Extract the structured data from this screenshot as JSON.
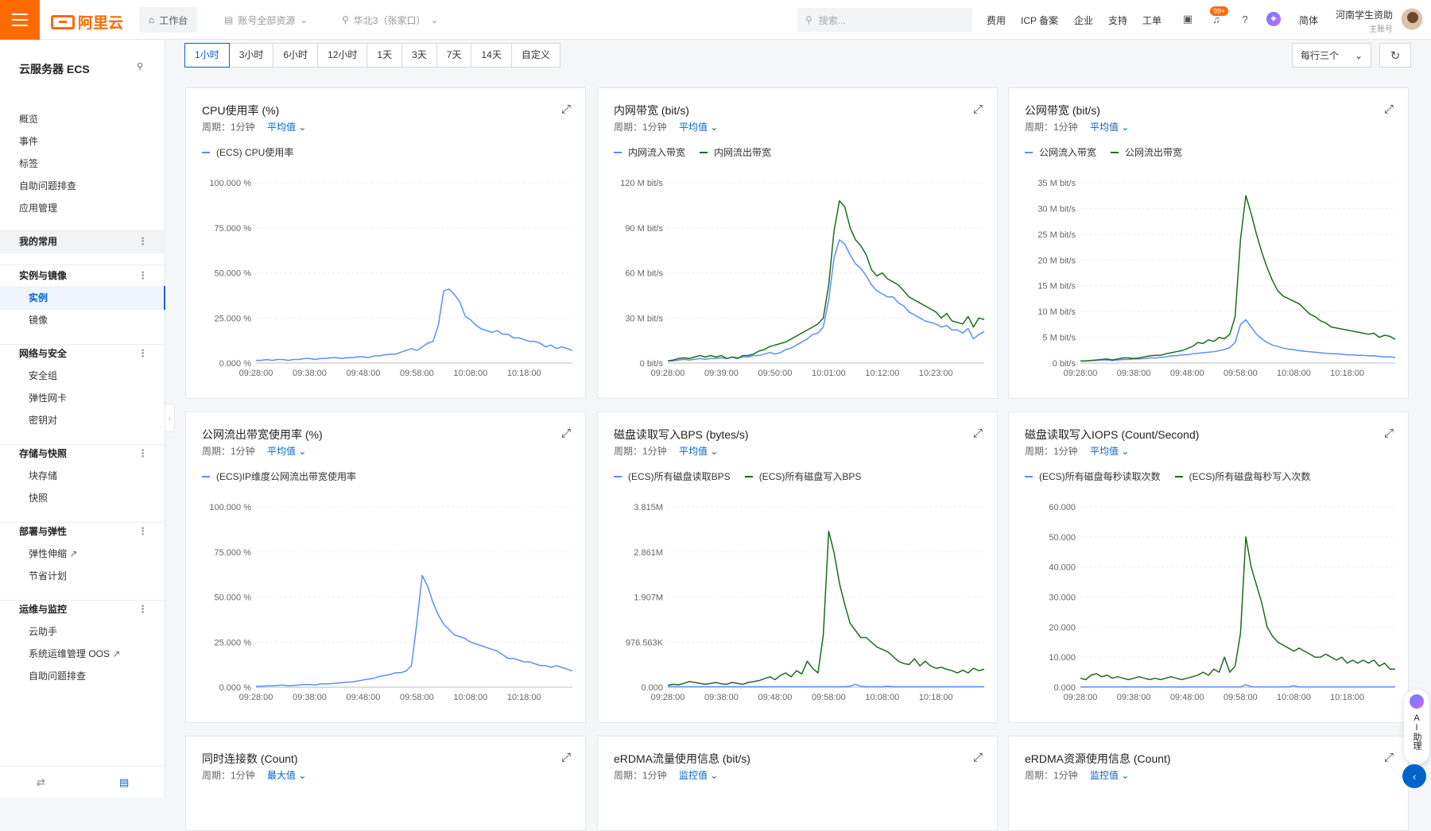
{
  "topbar": {
    "logo_text": "阿里云",
    "workbench": "工作台",
    "resource_scope": "账号全部资源",
    "region": "华北3（张家口）",
    "search_placeholder": "搜索...",
    "links": [
      "费用",
      "ICP 备案",
      "企业",
      "支持",
      "工单"
    ],
    "notif_badge": "99+",
    "lang": "简体",
    "account_name": "河南学生资助",
    "account_sub": "主账号"
  },
  "sidebar": {
    "title": "云服务器 ECS",
    "items": [
      {
        "label": "概览",
        "type": "item"
      },
      {
        "label": "事件",
        "type": "item"
      },
      {
        "label": "标签",
        "type": "item"
      },
      {
        "label": "自助问题排查",
        "type": "item"
      },
      {
        "label": "应用管理",
        "type": "item"
      },
      {
        "label": "我的常用",
        "type": "group"
      },
      {
        "label": "实例与镜像",
        "type": "group"
      },
      {
        "label": "实例",
        "type": "sub"
      },
      {
        "label": "镜像",
        "type": "sub"
      },
      {
        "label": "网络与安全",
        "type": "group"
      },
      {
        "label": "安全组",
        "type": "sub"
      },
      {
        "label": "弹性网卡",
        "type": "sub"
      },
      {
        "label": "密钥对",
        "type": "sub"
      },
      {
        "label": "存储与快照",
        "type": "group"
      },
      {
        "label": "块存储",
        "type": "sub"
      },
      {
        "label": "快照",
        "type": "sub"
      },
      {
        "label": "部署与弹性",
        "type": "group"
      },
      {
        "label": "弹性伸缩",
        "type": "sub"
      },
      {
        "label": "节省计划",
        "type": "sub"
      },
      {
        "label": "运维与监控",
        "type": "group"
      },
      {
        "label": "云助手",
        "type": "sub"
      },
      {
        "label": "系统运维管理 OOS",
        "type": "sub"
      },
      {
        "label": "自助问题排查",
        "type": "sub"
      }
    ]
  },
  "time_ranges": [
    "1小时",
    "3小时",
    "6小时",
    "12小时",
    "1天",
    "3天",
    "7天",
    "14天",
    "自定义"
  ],
  "active_range": "1小时",
  "per_row": "每行三个",
  "period_label": "周期：1分钟",
  "ai_assistant": "AI助理",
  "colors": {
    "blue": "#5b8ff9",
    "green": "#1e6b1e",
    "accent": "#0064c8",
    "brand": "#ff6a00"
  },
  "panels": [
    {
      "title": "CPU使用率 (%)",
      "agg": "平均值",
      "chart_data": {
        "type": "line",
        "x": [
          "09:28:00",
          "09:38:00",
          "09:48:00",
          "09:58:00",
          "10:08:00",
          "10:18:00"
        ],
        "y_ticks": [
          "0.000 %",
          "25.000 %",
          "50.000 %",
          "75.000 %",
          "100.000 %"
        ],
        "ylim": [
          0,
          100
        ],
        "series": [
          {
            "name": "(ECS) CPU使用率",
            "color": "blue",
            "values": [
              1.5,
              1.5,
              2,
              1.5,
              2,
              2,
              1.5,
              2,
              2,
              2.5,
              2.5,
              2,
              2.5,
              2.5,
              3,
              3,
              2.5,
              3,
              3,
              3.5,
              3.5,
              3,
              4,
              4,
              4.5,
              5,
              5,
              6,
              7,
              8,
              7,
              9,
              11,
              12,
              21,
              40,
              41,
              38,
              34,
              26,
              24,
              21,
              19,
              18,
              17,
              18,
              16,
              16,
              14,
              14,
              13,
              12,
              12,
              11,
              9,
              10,
              8,
              9,
              8,
              7
            ]
          }
        ]
      }
    },
    {
      "title": "内网带宽 (bit/s)",
      "agg": "平均值",
      "chart_data": {
        "type": "line",
        "x": [
          "09:28:00",
          "09:39:00",
          "09:50:00",
          "10:01:00",
          "10:12:00",
          "10:23:00"
        ],
        "y_ticks": [
          "0  bit/s",
          "30 M bit/s",
          "60 M bit/s",
          "90 M bit/s",
          "120 M bit/s"
        ],
        "ylim": [
          0,
          120
        ],
        "series": [
          {
            "name": "内网流入带宽",
            "color": "blue",
            "values": [
              1.5,
              1.5,
              2,
              2.5,
              2,
              2.5,
              3,
              2.5,
              3,
              3,
              3.5,
              3,
              4,
              3.5,
              4,
              4,
              5,
              5,
              6,
              7,
              6,
              7,
              9,
              10,
              12,
              14,
              16,
              19,
              20,
              24,
              42,
              70,
              82,
              79,
              72,
              66,
              63,
              58,
              52,
              48,
              46,
              44,
              44,
              40,
              38,
              34,
              32,
              30,
              28,
              27,
              26,
              24,
              25,
              22,
              22,
              20,
              23,
              16,
              19,
              21
            ]
          },
          {
            "name": "内网流出带宽",
            "color": "green",
            "values": [
              1.5,
              2,
              3,
              3.5,
              3,
              4,
              5,
              4,
              5,
              4,
              5,
              3,
              4,
              3,
              5,
              5,
              6,
              8,
              9,
              11,
              12,
              13,
              14,
              16,
              18,
              20,
              22,
              24,
              26,
              30,
              52,
              88,
              108,
              104,
              90,
              82,
              78,
              72,
              62,
              58,
              60,
              56,
              54,
              52,
              48,
              44,
              42,
              40,
              38,
              36,
              34,
              30,
              33,
              28,
              27,
              26,
              31,
              24,
              30,
              29
            ]
          }
        ]
      }
    },
    {
      "title": "公网带宽 (bit/s)",
      "agg": "平均值",
      "chart_data": {
        "type": "line",
        "x": [
          "09:28:00",
          "09:38:00",
          "09:48:00",
          "09:58:00",
          "10:08:00",
          "10:18:00"
        ],
        "y_ticks": [
          "0  bit/s",
          "5 M bit/s",
          "10 M bit/s",
          "15 M bit/s",
          "20 M bit/s",
          "25 M bit/s",
          "30 M bit/s",
          "35 M bit/s"
        ],
        "ylim": [
          0,
          35
        ],
        "series": [
          {
            "name": "公网流入带宽",
            "color": "blue",
            "values": [
              0.4,
              0.4,
              0.5,
              0.5,
              0.6,
              0.6,
              0.5,
              0.6,
              0.7,
              0.7,
              0.8,
              0.8,
              0.9,
              1.0,
              1.0,
              1.1,
              1.2,
              1.4,
              1.4,
              1.6,
              1.6,
              1.8,
              1.9,
              2.0,
              2.1,
              2.2,
              2.4,
              2.6,
              3.0,
              4.0,
              7.5,
              8.4,
              7.0,
              5.6,
              4.7,
              4.0,
              3.5,
              3.2,
              2.9,
              2.7,
              2.6,
              2.4,
              2.3,
              2.2,
              2.1,
              2.0,
              1.9,
              1.8,
              1.8,
              1.7,
              1.6,
              1.6,
              1.5,
              1.5,
              1.4,
              1.4,
              1.3,
              1.2,
              1.2,
              1.1
            ]
          },
          {
            "name": "公网流出带宽",
            "color": "green",
            "values": [
              0.4,
              0.4,
              0.5,
              0.6,
              0.7,
              0.8,
              0.6,
              0.8,
              1.0,
              1.0,
              0.9,
              1.0,
              1.2,
              1.4,
              1.5,
              1.5,
              1.8,
              2.0,
              2.2,
              2.4,
              2.8,
              3.2,
              4.0,
              3.8,
              4.5,
              4.2,
              5.0,
              4.7,
              5.6,
              9.0,
              24.0,
              32.5,
              29.0,
              25.0,
              21.5,
              18.5,
              16.0,
              14.0,
              13.0,
              12.5,
              12.0,
              11.5,
              10.5,
              9.5,
              9.0,
              8.2,
              7.8,
              7.0,
              6.8,
              6.6,
              6.4,
              6.2,
              6.0,
              5.8,
              5.6,
              5.8,
              5.0,
              5.4,
              5.2,
              4.6
            ]
          }
        ]
      }
    },
    {
      "title": "公网流出带宽使用率 (%)",
      "agg": "平均值",
      "chart_data": {
        "type": "line",
        "x": [
          "09:28:00",
          "09:38:00",
          "09:48:00",
          "09:58:00",
          "10:08:00",
          "10:18:00"
        ],
        "y_ticks": [
          "0.000 %",
          "25.000 %",
          "50.000 %",
          "75.000 %",
          "100.000 %"
        ],
        "ylim": [
          0,
          100
        ],
        "series": [
          {
            "name": "(ECS)IP维度公网流出带宽使用率",
            "color": "blue",
            "values": [
              0.5,
              0.5,
              0.8,
              0.8,
              1.0,
              1.2,
              0.8,
              1.0,
              1.2,
              1.5,
              1.5,
              1.2,
              1.8,
              1.8,
              2.0,
              2.2,
              2.5,
              2.8,
              3.0,
              3.5,
              4,
              4.5,
              5,
              6,
              6.5,
              7,
              8,
              8,
              9,
              12,
              36,
              62,
              56,
              47,
              40,
              35,
              32,
              29,
              28,
              27,
              25,
              24,
              23,
              22,
              21,
              20,
              18,
              16,
              16,
              15,
              14,
              14,
              13,
              12,
              12,
              11,
              12,
              11,
              10,
              9
            ]
          }
        ]
      }
    },
    {
      "title": "磁盘读取写入BPS (bytes/s)",
      "agg": "平均值",
      "chart_data": {
        "type": "line",
        "x": [
          "09:28:00",
          "09:38:00",
          "09:48:00",
          "09:58:00",
          "10:08:00",
          "10:18:00"
        ],
        "y_ticks": [
          "0.000",
          "976.563K",
          "1.907M",
          "2.861M",
          "3.815M"
        ],
        "ylim": [
          0,
          3.815
        ],
        "series": [
          {
            "name": "(ECS)所有磁盘读取BPS",
            "color": "blue",
            "values": [
              0.01,
              0.01,
              0.01,
              0.01,
              0.01,
              0.01,
              0.01,
              0.01,
              0.01,
              0.01,
              0.01,
              0.01,
              0.01,
              0.01,
              0.01,
              0.01,
              0.01,
              0.01,
              0.01,
              0.01,
              0.01,
              0.01,
              0.01,
              0.01,
              0.01,
              0.01,
              0.01,
              0.01,
              0.01,
              0.01,
              0.01,
              0.01,
              0.01,
              0.01,
              0.02,
              0.06,
              0.02,
              0.01,
              0.01,
              0.01,
              0.01,
              0.02,
              0.01,
              0.01,
              0.01,
              0.01,
              0.01,
              0.01,
              0.01,
              0.01,
              0.01,
              0.01,
              0.01,
              0.01,
              0.01,
              0.01,
              0.01,
              0.01,
              0.01,
              0.01
            ]
          },
          {
            "name": "(ECS)所有磁盘写入BPS",
            "color": "green",
            "values": [
              0.04,
              0.06,
              0.05,
              0.08,
              0.12,
              0.1,
              0.08,
              0.06,
              0.08,
              0.1,
              0.07,
              0.06,
              0.1,
              0.08,
              0.06,
              0.1,
              0.12,
              0.14,
              0.18,
              0.22,
              0.16,
              0.25,
              0.3,
              0.22,
              0.35,
              0.28,
              0.55,
              0.4,
              0.3,
              1.1,
              3.3,
              2.85,
              2.2,
              1.75,
              1.35,
              1.2,
              1.05,
              1.05,
              0.95,
              0.85,
              0.8,
              0.75,
              0.65,
              0.55,
              0.5,
              0.48,
              0.6,
              0.45,
              0.55,
              0.45,
              0.4,
              0.42,
              0.38,
              0.35,
              0.3,
              0.36,
              0.3,
              0.4,
              0.35,
              0.38
            ]
          }
        ]
      }
    },
    {
      "title": "磁盘读取写入IOPS (Count/Second)",
      "agg": "平均值",
      "chart_data": {
        "type": "line",
        "x": [
          "09:28:00",
          "09:38:00",
          "09:48:00",
          "09:58:00",
          "10:08:00",
          "10:18:00"
        ],
        "y_ticks": [
          "0.000",
          "10.000",
          "20.000",
          "30.000",
          "40.000",
          "50.000",
          "60.000"
        ],
        "ylim": [
          0,
          60
        ],
        "series": [
          {
            "name": "(ECS)所有磁盘每秒读取次数",
            "color": "blue",
            "values": [
              0.1,
              0.1,
              0.1,
              0.1,
              0.1,
              0.1,
              0.1,
              0.1,
              0.1,
              0.1,
              0.1,
              0.1,
              0.1,
              0.1,
              0.1,
              0.1,
              0.1,
              0.1,
              0.1,
              0.1,
              0.1,
              0.1,
              0.1,
              0.1,
              0.1,
              0.1,
              0.1,
              0.1,
              0.1,
              0.1,
              0.1,
              0.8,
              0.2,
              0.1,
              0.1,
              0.1,
              0.1,
              0.1,
              0.1,
              0.1,
              0.5,
              0.1,
              0.1,
              0.1,
              0.1,
              0.1,
              0.1,
              0.1,
              0.1,
              0.1,
              0.1,
              0.1,
              0.1,
              0.1,
              0.1,
              0.1,
              0.1,
              0.1,
              0.1,
              0.1
            ]
          },
          {
            "name": "(ECS)所有磁盘每秒写入次数",
            "color": "green",
            "values": [
              3,
              2.5,
              4,
              4.5,
              3.5,
              4,
              3,
              3.5,
              3,
              2.5,
              3,
              3.5,
              3,
              2.5,
              3,
              2.5,
              3,
              3.5,
              3,
              2.5,
              3,
              3.5,
              4,
              5,
              4,
              6,
              5,
              10,
              5,
              7,
              18,
              50,
              40,
              34,
              28,
              20,
              17,
              15,
              14,
              13,
              12,
              13,
              12,
              11,
              10,
              10,
              11,
              10,
              9,
              10,
              8,
              9,
              8,
              9,
              8,
              9,
              7,
              8,
              6,
              6
            ]
          }
        ]
      }
    }
  ],
  "bottom_panels": [
    {
      "title": "同时连接数 (Count)",
      "agg": "最大值"
    },
    {
      "title": "eRDMA流量使用信息 (bit/s)",
      "agg": "监控值"
    },
    {
      "title": "eRDMA资源使用信息 (Count)",
      "agg": "监控值"
    }
  ]
}
